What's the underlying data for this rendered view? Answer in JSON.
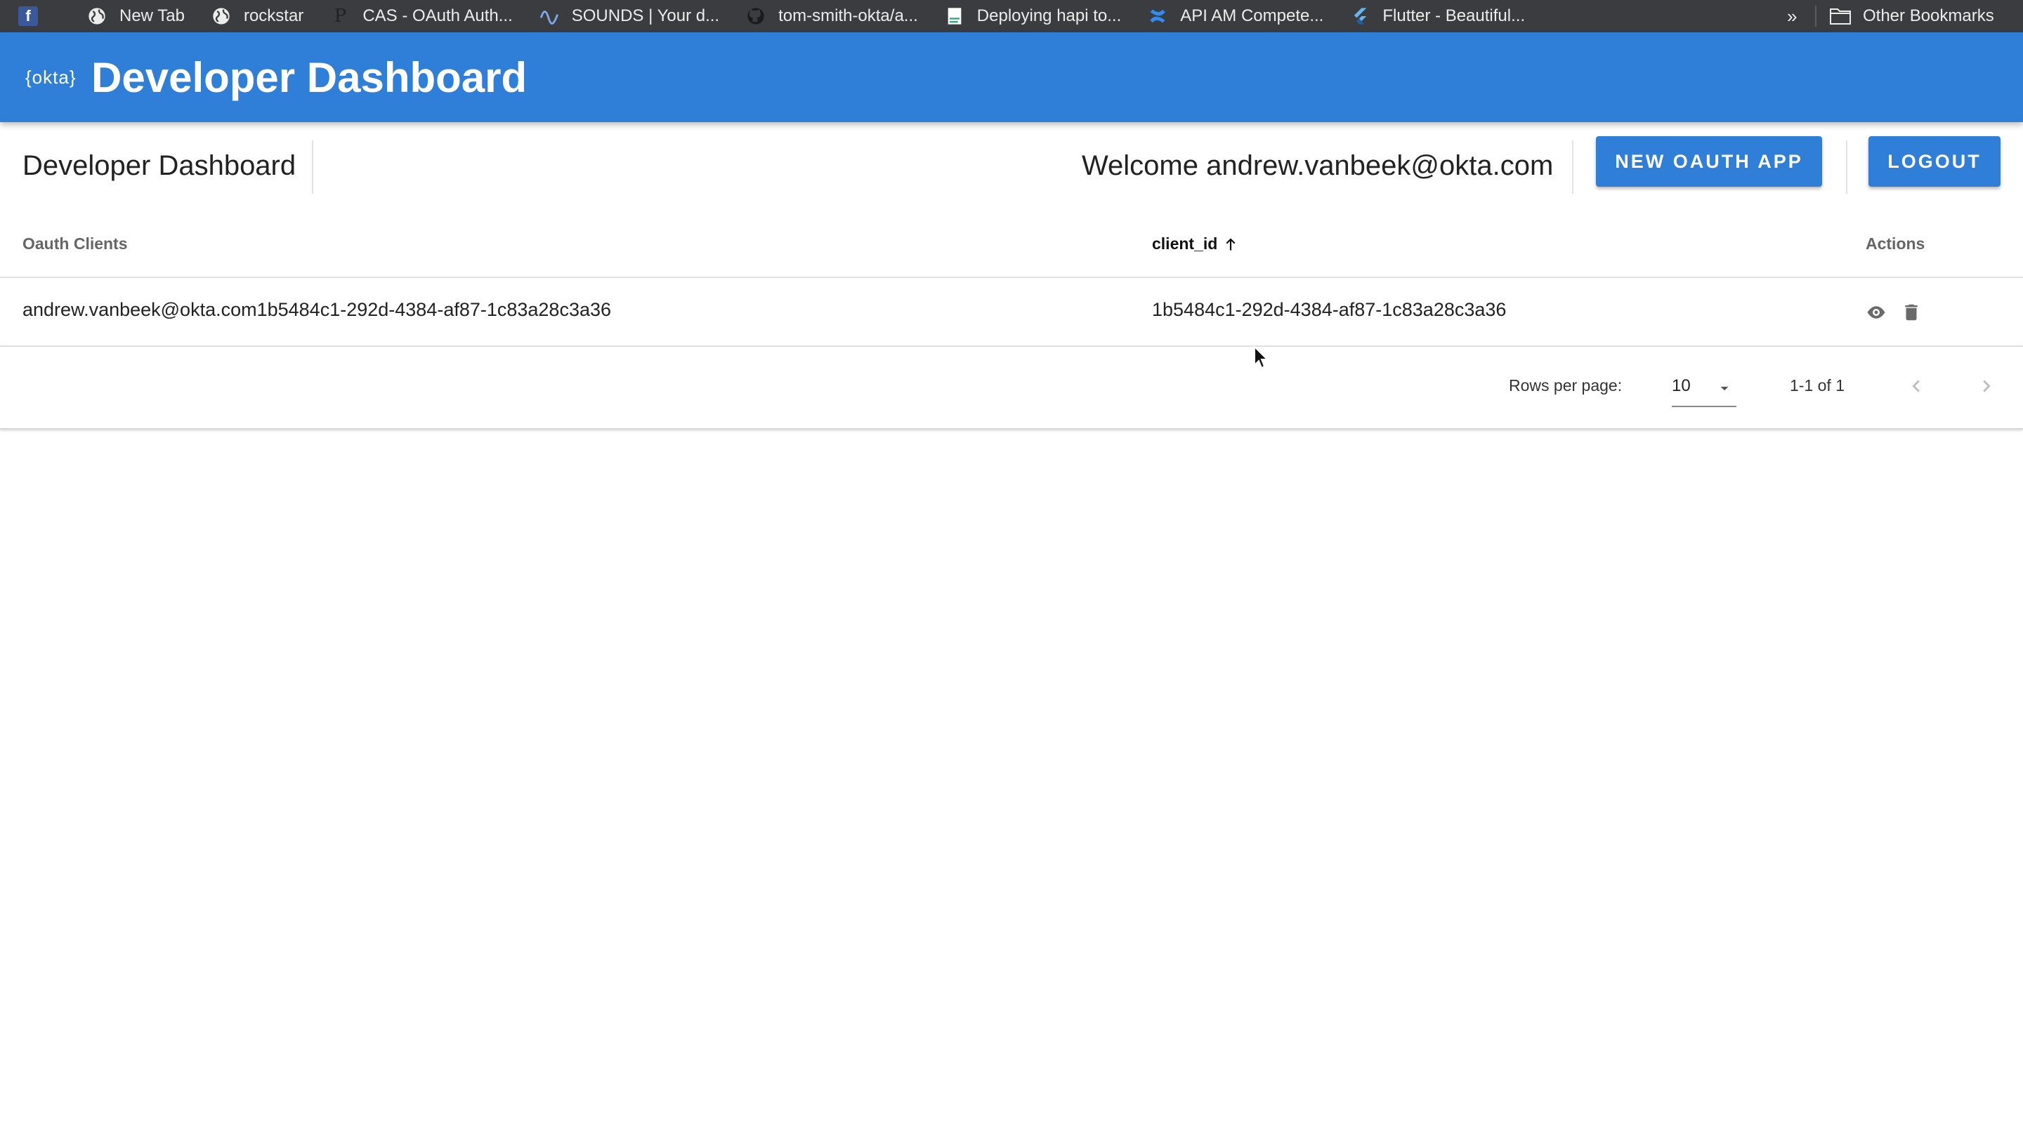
{
  "bookmarks": [
    {
      "label": "",
      "icon": "facebook-icon"
    },
    {
      "label": "New Tab",
      "icon": "globe-icon"
    },
    {
      "label": "rockstar",
      "icon": "globe-icon"
    },
    {
      "label": "CAS - OAuth Auth...",
      "icon": "p-letter-icon"
    },
    {
      "label": "SOUNDS | Your d...",
      "icon": "wave-icon"
    },
    {
      "label": "tom-smith-okta/a...",
      "icon": "github-icon"
    },
    {
      "label": "Deploying hapi to...",
      "icon": "document-icon"
    },
    {
      "label": "API AM Compete...",
      "icon": "confluence-icon"
    },
    {
      "label": "Flutter - Beautiful...",
      "icon": "flutter-icon"
    }
  ],
  "bookmarks_more": "»",
  "other_bookmarks": "Other Bookmarks",
  "appbar": {
    "logo": "{okta}",
    "title": "Developer Dashboard",
    "color": "#2f7fd8"
  },
  "toolbar": {
    "title": "Developer Dashboard",
    "welcome": "Welcome andrew.vanbeek@okta.com",
    "new_app_label": "NEW OAUTH APP",
    "logout_label": "LOGOUT"
  },
  "table": {
    "columns": [
      "Oauth Clients",
      "client_id",
      "Actions"
    ],
    "sorted_column": "client_id",
    "sort_direction": "ascending",
    "rows": [
      {
        "name": "andrew.vanbeek@okta.com1b5484c1-292d-4384-af87-1c83a28c3a36",
        "client_id": "1b5484c1-292d-4384-af87-1c83a28c3a36",
        "actions": [
          "eye-icon",
          "trash-icon"
        ]
      }
    ]
  },
  "pagination": {
    "rows_per_page_label": "Rows per page:",
    "rows_per_page": "10",
    "range": "1-1 of 1"
  }
}
